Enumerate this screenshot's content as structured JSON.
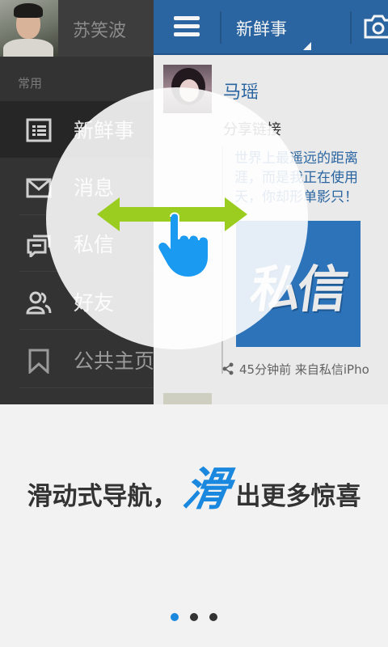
{
  "sidebar": {
    "username": "苏笑波",
    "section_label": "常用",
    "items": [
      {
        "label": "新鲜事",
        "icon": "news-feed-icon",
        "active": true
      },
      {
        "label": "消息",
        "icon": "envelope-icon",
        "active": false
      },
      {
        "label": "私信",
        "icon": "chat-bubbles-icon",
        "active": false
      },
      {
        "label": "好友",
        "icon": "friends-icon",
        "active": false
      },
      {
        "label": "公共主页",
        "icon": "bookmark-icon",
        "active": false
      }
    ]
  },
  "topbar": {
    "title": "新鲜事",
    "menu_icon": "hamburger-menu-icon",
    "camera_icon": "camera-icon"
  },
  "post": {
    "author": "马瑶",
    "action": "分享链接",
    "quote": "世界上最遥远的距离\n涯，而是我正在使用\n天，你却形单影只！",
    "image_text": "私信",
    "meta": "45分钟前 来自私信iPho",
    "share_icon": "share-icon"
  },
  "overlay": {
    "arrow_icon": "double-arrow-icon",
    "hand_icon": "swipe-hand-icon",
    "arrow_color": "#9acd1f",
    "hand_color": "#1a9af0"
  },
  "promo": {
    "slogan_before": "滑动式导航，",
    "slogan_highlight": "滑",
    "slogan_after": "出更多惊喜",
    "highlight_color": "#1a88de"
  },
  "pager": {
    "pages": 3,
    "active_index": 0
  },
  "colors": {
    "header_blue": "#2c6aa8",
    "sidebar_bg": "#333333"
  }
}
